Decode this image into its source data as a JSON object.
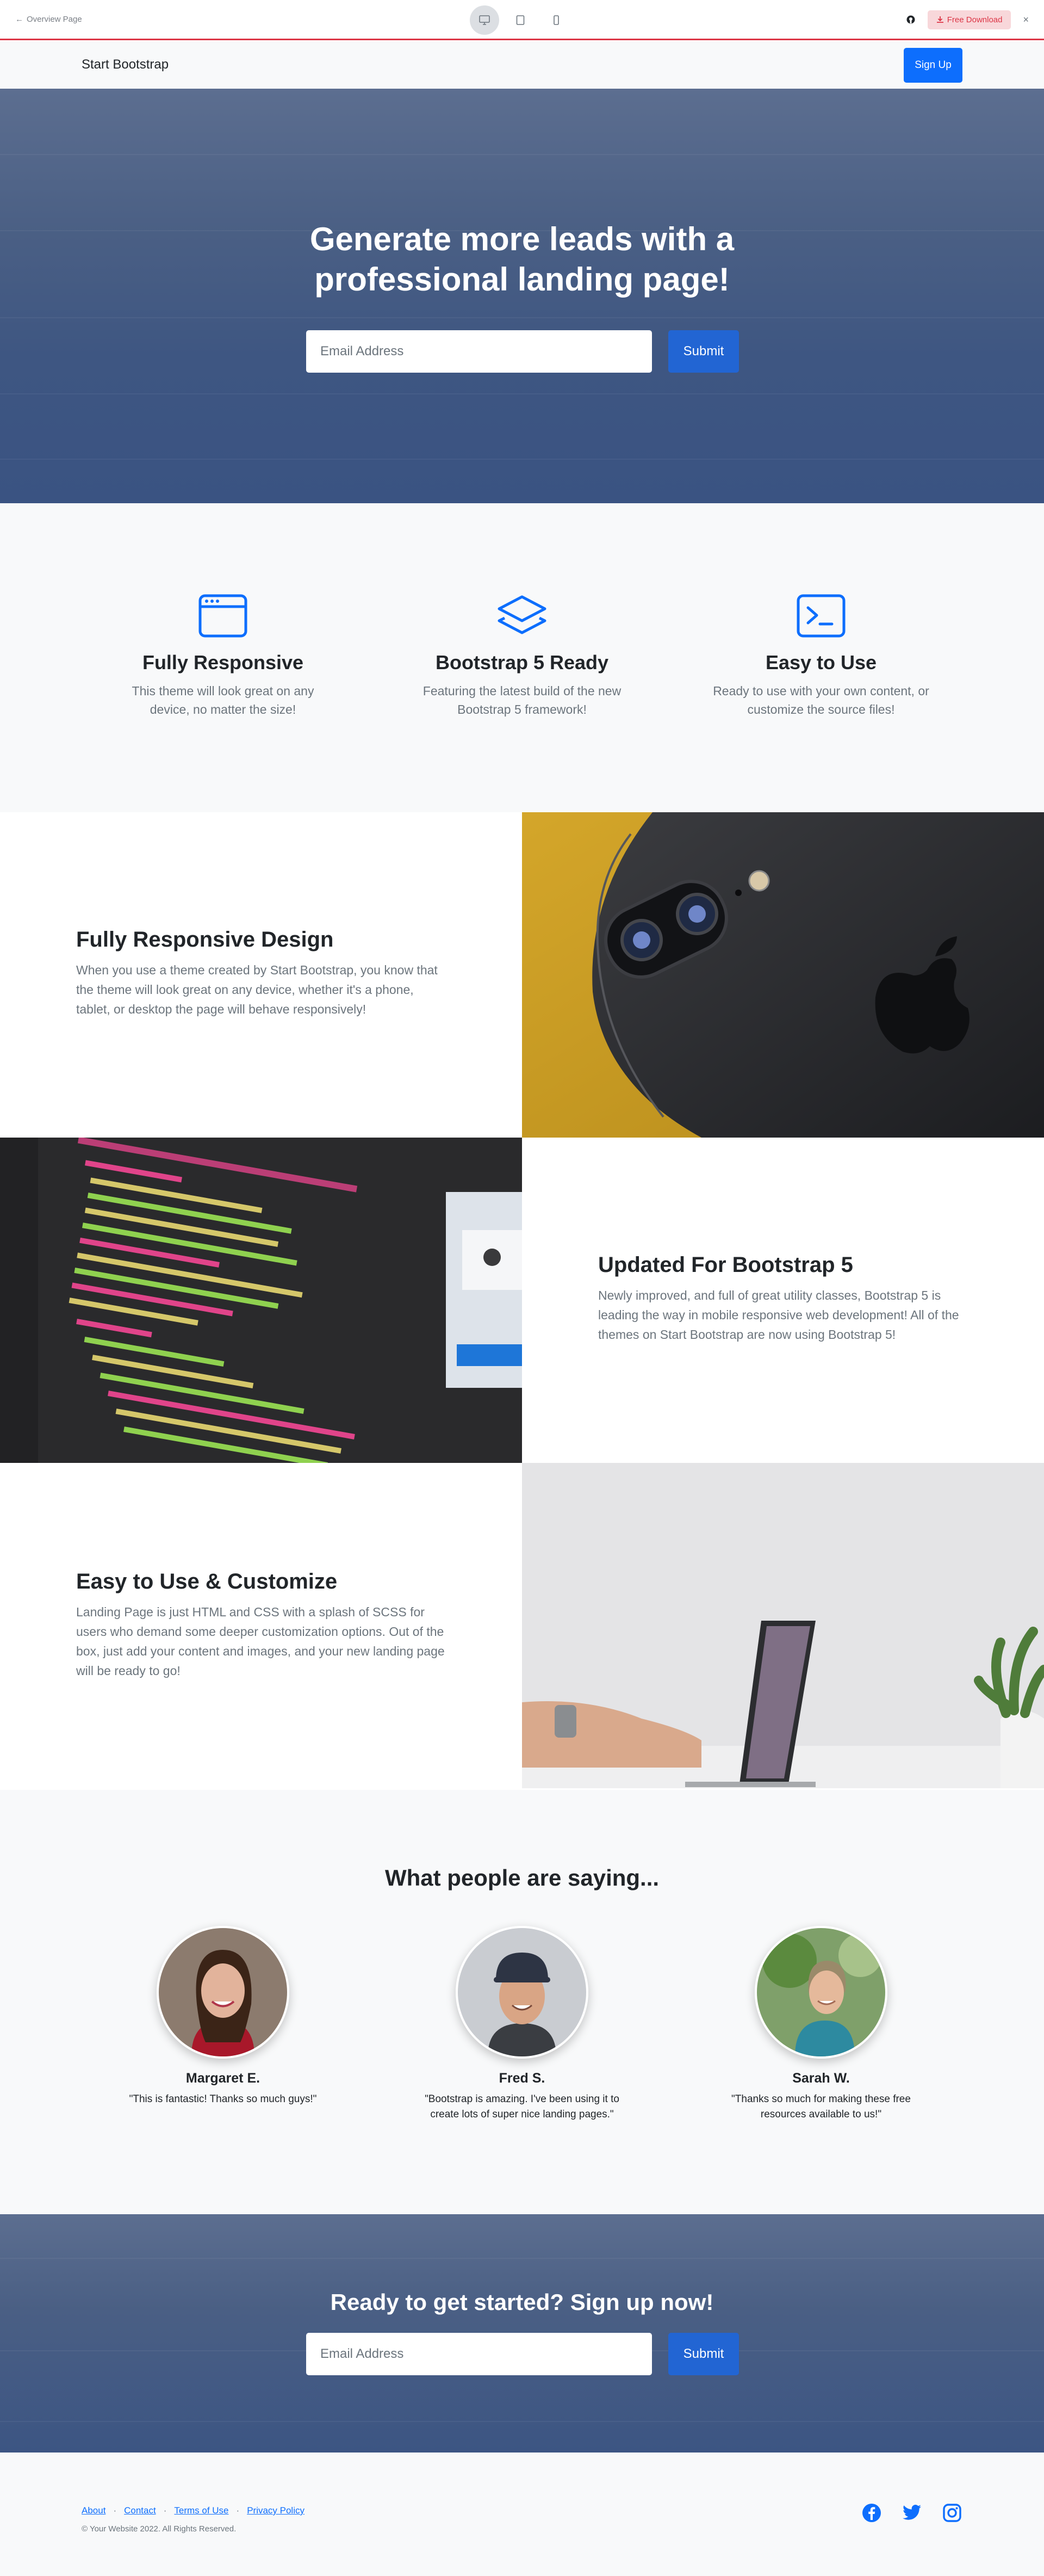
{
  "preview_bar": {
    "back_label": "Overview Page",
    "download_label": "Free Download",
    "icons": [
      "desktop-icon",
      "tablet-icon",
      "mobile-icon",
      "github-icon",
      "download-icon",
      "close-icon"
    ]
  },
  "navbar": {
    "brand": "Start Bootstrap",
    "signup_label": "Sign Up"
  },
  "masthead": {
    "heading_line1": "Generate more leads with a",
    "heading_line2": "professional landing page!",
    "email_placeholder": "Email Address",
    "submit_label": "Submit"
  },
  "features": [
    {
      "icon": "window-icon",
      "title": "Fully Responsive",
      "text": "This theme will look great on any device, no matter the size!"
    },
    {
      "icon": "layers-icon",
      "title": "Bootstrap 5 Ready",
      "text": "Featuring the latest build of the new Bootstrap 5 framework!"
    },
    {
      "icon": "terminal-icon",
      "title": "Easy to Use",
      "text": "Ready to use with your own content, or customize the source files!"
    }
  ],
  "showcase": [
    {
      "title": "Fully Responsive Design",
      "text": "When you use a theme created by Start Bootstrap, you know that the theme will look great on any device, whether it's a phone, tablet, or desktop the page will behave responsively!"
    },
    {
      "title": "Updated For Bootstrap 5",
      "text": "Newly improved, and full of great utility classes, Bootstrap 5 is leading the way in mobile responsive web development! All of the themes on Start Bootstrap are now using Bootstrap 5!"
    },
    {
      "title": "Easy to Use & Customize",
      "text": "Landing Page is just HTML and CSS with a splash of SCSS for users who demand some deeper customization options. Out of the box, just add your content and images, and your new landing page will be ready to go!"
    }
  ],
  "testimonials": {
    "heading": "What people are saying...",
    "items": [
      {
        "name": "Margaret E.",
        "quote": "\"This is fantastic! Thanks so much guys!\""
      },
      {
        "name": "Fred S.",
        "quote": "\"Bootstrap is amazing. I've been using it to create lots of super nice landing pages.\""
      },
      {
        "name": "Sarah W.",
        "quote": "\"Thanks so much for making these free resources available to us!\""
      }
    ]
  },
  "cta": {
    "heading": "Ready to get started? Sign up now!",
    "email_placeholder": "Email Address",
    "submit_label": "Submit"
  },
  "footer": {
    "links": [
      "About",
      "Contact",
      "Terms of Use",
      "Privacy Policy"
    ],
    "separator": "·",
    "copyright": "© Your Website 2022. All Rights Reserved.",
    "social": [
      "facebook-icon",
      "twitter-icon",
      "instagram-icon"
    ]
  },
  "colors": {
    "primary": "#0d6efd",
    "danger": "#dc3545",
    "light_bg": "#f8f9fa",
    "muted_text": "#6c757d"
  }
}
